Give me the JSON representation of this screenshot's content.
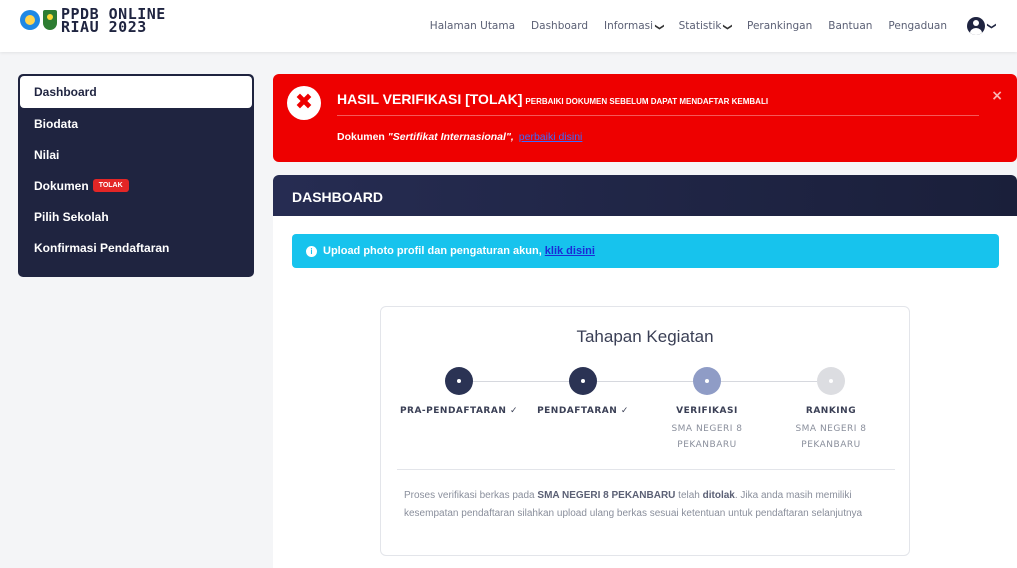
{
  "brand": {
    "line1": "PPDB ONLINE",
    "line2": "RIAU 2023"
  },
  "nav": {
    "items": [
      {
        "label": "Halaman Utama",
        "dropdown": false
      },
      {
        "label": "Dashboard",
        "dropdown": false
      },
      {
        "label": "Informasi",
        "dropdown": true
      },
      {
        "label": "Statistik",
        "dropdown": true
      },
      {
        "label": "Perankingan",
        "dropdown": false
      },
      {
        "label": "Bantuan",
        "dropdown": false
      },
      {
        "label": "Pengaduan",
        "dropdown": false
      }
    ],
    "caret": "❯"
  },
  "sidebar": {
    "items": [
      {
        "label": "Dashboard",
        "active": true
      },
      {
        "label": "Biodata"
      },
      {
        "label": "Nilai"
      },
      {
        "label": "Dokumen",
        "badge": "TOLAK"
      },
      {
        "label": "Pilih Sekolah"
      },
      {
        "label": "Konfirmasi Pendaftaran"
      }
    ]
  },
  "alert": {
    "icon": "✖",
    "title": "HASIL VERIFIKASI [TOLAK]",
    "subtitle": "PERBAIKI DOKUMEN SEBELUM DAPAT MENDAFTAR KEMBALI",
    "doc_prefix": "Dokumen",
    "doc_name": "\"Sertifikat Internasional\",",
    "fix_link": "perbaiki disini",
    "close": "×",
    "color": "#ee0000"
  },
  "card": {
    "header": "DASHBOARD",
    "info": {
      "icon": "i",
      "text": "Upload photo profil dan pengaturan akun,",
      "link": "klik disini"
    }
  },
  "stages": {
    "title": "Tahapan Kegiatan",
    "steps": [
      {
        "label": "PRA-PENDAFTARAN ✓",
        "sub1": "",
        "sub2": "",
        "color": "#2b3354"
      },
      {
        "label": "PENDAFTARAN ✓",
        "sub1": "",
        "sub2": "",
        "color": "#2b3354"
      },
      {
        "label": "VERIFIKASI",
        "sub1": "SMA NEGERI 8",
        "sub2": "PEKANBARU",
        "color": "#8f9cc6"
      },
      {
        "label": "RANKING",
        "sub1": "SMA NEGERI 8",
        "sub2": "PEKANBARU",
        "color": "#dcdde1"
      }
    ],
    "note": {
      "p1": "Proses verifikasi berkas pada ",
      "school": "SMA NEGERI 8 PEKANBARU",
      "p2": " telah ",
      "status": "ditolak",
      "p3": ". Jika anda masih memiliki kesempatan pendaftaran silahkan upload ulang berkas sesuai ketentuan untuk pendaftaran selanjutnya"
    }
  }
}
